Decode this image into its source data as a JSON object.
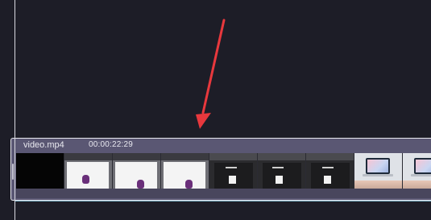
{
  "timeline": {
    "clip": {
      "name": "video.mp4",
      "duration": "00:00:22:29"
    }
  },
  "colors": {
    "background": "#1d1d27",
    "clip": "#5a5773",
    "annotation_arrow": "#e8383d"
  },
  "icons": [
    "playhead",
    "annotation-arrow",
    "clip-trim-handle"
  ]
}
